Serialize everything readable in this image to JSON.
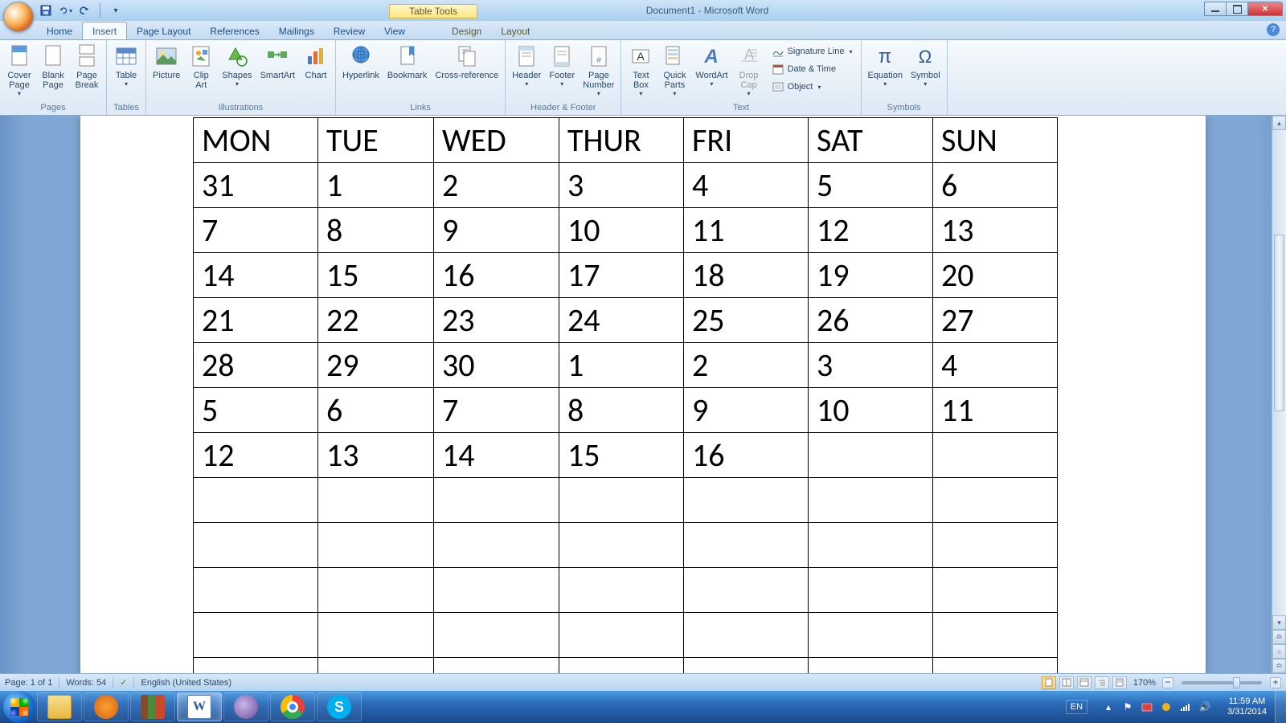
{
  "window": {
    "app_title": "Document1 - Microsoft Word",
    "table_tools": "Table Tools"
  },
  "tabs": {
    "home": "Home",
    "insert": "Insert",
    "layout_page": "Page Layout",
    "references": "References",
    "mailings": "Mailings",
    "review": "Review",
    "view": "View",
    "design": "Design",
    "layout_table": "Layout"
  },
  "ribbon": {
    "groups": {
      "pages": "Pages",
      "tables": "Tables",
      "illustrations": "Illustrations",
      "links": "Links",
      "header_footer": "Header & Footer",
      "text": "Text",
      "symbols": "Symbols"
    },
    "pages": {
      "cover": "Cover\nPage",
      "blank": "Blank\nPage",
      "break": "Page\nBreak"
    },
    "tables": {
      "table": "Table"
    },
    "illustrations": {
      "picture": "Picture",
      "clipart": "Clip\nArt",
      "shapes": "Shapes",
      "smartart": "SmartArt",
      "chart": "Chart"
    },
    "links": {
      "hyperlink": "Hyperlink",
      "bookmark": "Bookmark",
      "crossref": "Cross-reference"
    },
    "hf": {
      "header": "Header",
      "footer": "Footer",
      "pagenum": "Page\nNumber"
    },
    "text": {
      "textbox": "Text\nBox",
      "quickparts": "Quick\nParts",
      "wordart": "WordArt",
      "dropcap": "Drop\nCap",
      "sigline": "Signature Line",
      "datetime": "Date & Time",
      "object": "Object"
    },
    "symbols": {
      "equation": "Equation",
      "symbol": "Symbol"
    }
  },
  "calendar": {
    "headers": [
      "MON",
      "TUE",
      "WED",
      "THUR",
      "FRI",
      "SAT",
      "SUN"
    ],
    "rows": [
      [
        "31",
        "1",
        "2",
        "3",
        "4",
        "5",
        "6"
      ],
      [
        "7",
        "8",
        "9",
        "10",
        "11",
        "12",
        "13"
      ],
      [
        "14",
        "15",
        "16",
        "17",
        "18",
        "19",
        "20"
      ],
      [
        "21",
        "22",
        "23",
        "24",
        "25",
        "26",
        "27"
      ],
      [
        "28",
        "29",
        "30",
        "1",
        "2",
        "3",
        "4"
      ],
      [
        "5",
        "6",
        "7",
        "8",
        "9",
        "10",
        "11"
      ],
      [
        "12",
        "13",
        "14",
        "15",
        "16",
        "",
        ""
      ],
      [
        "",
        "",
        "",
        "",
        "",
        "",
        ""
      ],
      [
        "",
        "",
        "",
        "",
        "",
        "",
        ""
      ],
      [
        "",
        "",
        "",
        "",
        "",
        "",
        ""
      ],
      [
        "",
        "",
        "",
        "",
        "",
        "",
        ""
      ],
      [
        "",
        "",
        "",
        "",
        "",
        "",
        ""
      ]
    ]
  },
  "status": {
    "page": "Page: 1 of 1",
    "words": "Words: 54",
    "lang": "English (United States)",
    "zoom": "170%"
  },
  "tray": {
    "lang": "EN",
    "time": "11:59 AM",
    "date": "3/31/2014"
  }
}
